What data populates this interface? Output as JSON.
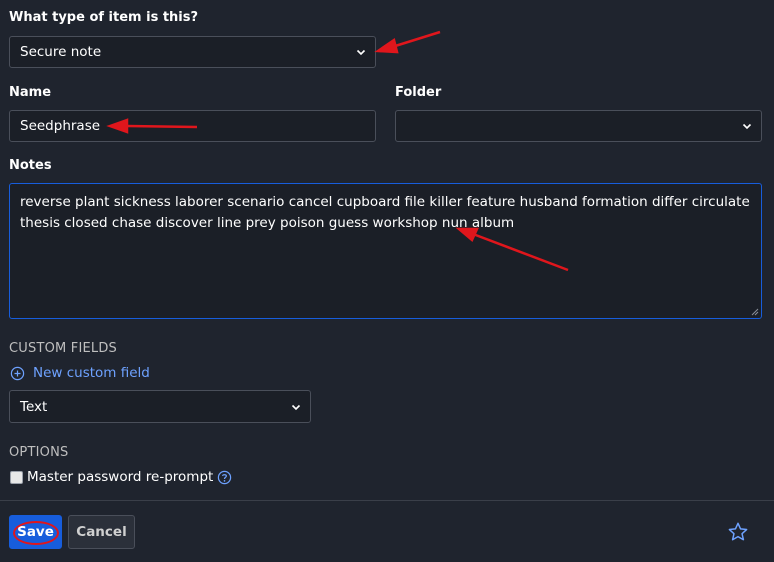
{
  "item_type": {
    "label": "What type of item is this?",
    "selected": "Secure note"
  },
  "name": {
    "label": "Name",
    "value": "Seedphrase"
  },
  "folder": {
    "label": "Folder",
    "selected": ""
  },
  "notes": {
    "label": "Notes",
    "value": "reverse plant sickness laborer scenario cancel cupboard file killer feature husband formation differ circulate thesis closed chase discover line prey poison guess workshop nun album"
  },
  "custom_fields": {
    "heading": "CUSTOM FIELDS",
    "new_link": "New custom field",
    "type_selected": "Text"
  },
  "options": {
    "heading": "OPTIONS",
    "reprompt_label": "Master password re-prompt",
    "reprompt_checked": false
  },
  "footer": {
    "save_label": "Save",
    "cancel_label": "Cancel"
  },
  "colors": {
    "background": "#1f242e",
    "accent": "#175ddc",
    "link": "#6ea2ff",
    "annotation": "#e0161c"
  },
  "icons": [
    "chevron-down-icon",
    "plus-circle-icon",
    "help-circle-icon",
    "star-icon",
    "resize-grip-icon",
    "red-arrow-annotation"
  ]
}
